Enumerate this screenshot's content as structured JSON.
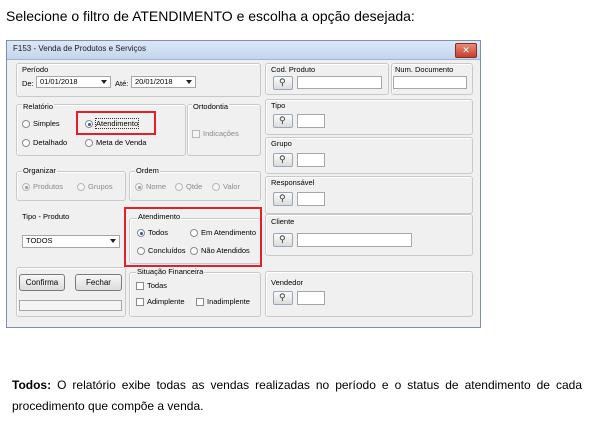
{
  "instruction": "Selecione o filtro de ATENDIMENTO e escolha a opção desejada:",
  "window": {
    "title": "F153 - Venda de Produtos e Serviços",
    "close_symbol": "✕"
  },
  "periodo": {
    "label": "Período",
    "de_label": "De:",
    "de_value": "01/01/2018",
    "ate_label": "Até:",
    "ate_value": "20/01/2018"
  },
  "relatorio": {
    "label": "Relatório",
    "simples": "Simples",
    "atendimento": "Atendimento",
    "detalhado": "Detalhado",
    "meta_venda": "Meta de Venda",
    "selected": "atendimento"
  },
  "ortodontia": {
    "label": "Ortodontia",
    "indicacoes": "Indicações"
  },
  "organizar": {
    "label": "Organizar",
    "produtos": "Produtos",
    "grupos": "Grupos"
  },
  "ordem": {
    "label": "Ordem",
    "nome": "Nome",
    "qtde": "Qtde",
    "valor": "Valor"
  },
  "tipo_produto": {
    "label": "Tipo - Produto",
    "value": "TODOS"
  },
  "atendimento": {
    "label": "Atendimento",
    "todos": "Todos",
    "em_atendimento": "Em Atendimento",
    "concluidos": "Concluídos",
    "nao_atendidos": "Não Atendidos",
    "selected": "todos"
  },
  "buttons": {
    "confirma": "Confirma",
    "fechar": "Fechar"
  },
  "situacao": {
    "label": "Situação Financeira",
    "todas": "Todas",
    "adimplente": "Adimplente",
    "inadimplente": "Inadimplente"
  },
  "right": {
    "cod_produto": "Cod. Produto",
    "num_documento": "Num. Documento",
    "tipo": "Tipo",
    "grupo": "Grupo",
    "responsavel": "Responsável",
    "cliente": "Cliente",
    "vendedor": "Vendedor"
  },
  "description": {
    "term": "Todos:",
    "text": " O relatório exibe todas as vendas realizadas no período e o status de atendimento de cada procedimento que compõe a venda."
  },
  "colors": {
    "highlight": "#e0202a"
  }
}
